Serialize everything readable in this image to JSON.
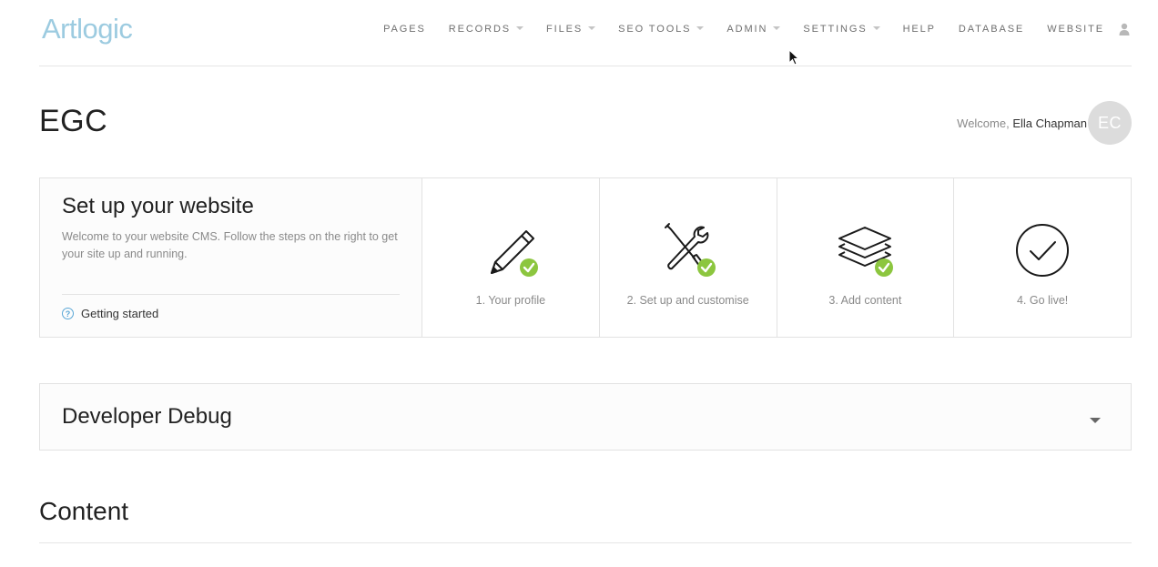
{
  "header": {
    "logo_text": "Artlogic",
    "nav": [
      {
        "label": "PAGES",
        "dropdown": false
      },
      {
        "label": "RECORDS",
        "dropdown": true
      },
      {
        "label": "FILES",
        "dropdown": true
      },
      {
        "label": "SEO TOOLS",
        "dropdown": true
      },
      {
        "label": "ADMIN",
        "dropdown": true
      },
      {
        "label": "SETTINGS",
        "dropdown": true
      },
      {
        "label": "HELP",
        "dropdown": false
      },
      {
        "label": "DATABASE",
        "dropdown": false
      },
      {
        "label": "WEBSITE",
        "dropdown": false
      }
    ],
    "user_icon": "user-icon"
  },
  "page": {
    "title": "EGC",
    "welcome_prefix": "Welcome,",
    "user_name": "Ella Chapman",
    "avatar_initials": "EC"
  },
  "setup": {
    "title": "Set up your website",
    "description": "Welcome to your website CMS. Follow the steps on the right to get your site up and running.",
    "getting_started": "Getting started",
    "steps": [
      {
        "label": "1. Your profile",
        "icon": "pencil-icon",
        "completed": true
      },
      {
        "label": "2. Set up and customise",
        "icon": "tools-icon",
        "completed": true
      },
      {
        "label": "3. Add content",
        "icon": "layers-icon",
        "completed": true
      },
      {
        "label": "4. Go live!",
        "icon": "check-circle-icon",
        "completed": false
      }
    ]
  },
  "debug": {
    "title": "Developer Debug"
  },
  "content": {
    "title": "Content"
  },
  "colors": {
    "logo": "#9ccbe0",
    "check_badge": "#8cc63f",
    "help_icon": "#5aa7d6",
    "avatar_bg": "#dcdcdc"
  }
}
